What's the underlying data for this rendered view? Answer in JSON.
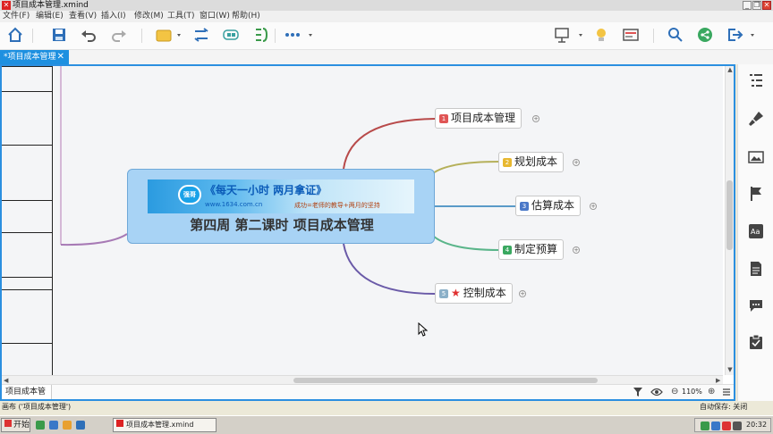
{
  "window": {
    "title": "项目成本管理.xmind",
    "minimize": "_",
    "restore": "❐",
    "close": "✕"
  },
  "menu": [
    "文件(F)",
    "编辑(E)",
    "查看(V)",
    "插入(I)",
    "修改(M)",
    "工具(T)",
    "窗口(W)",
    "帮助(H)"
  ],
  "toolbar": {
    "icons": [
      "home-icon",
      "save-icon",
      "undo-icon",
      "redo-icon",
      "topic-icon",
      "relationship-icon",
      "boundary-icon",
      "summary-icon",
      "more-icon",
      "presentation-icon",
      "idea-icon",
      "layout-icon",
      "search-icon",
      "share-icon",
      "export-icon"
    ]
  },
  "tab": {
    "label": "*项目成本管理",
    "close": "✕"
  },
  "mindmap": {
    "central": {
      "banner_badge": "强哥",
      "banner_slogan": "《每天一小时 两月拿证》",
      "banner_site": "www.1634.com.cn",
      "banner_motto": "成功=老师的教导+两月的坚持",
      "title": "第四周  第二课时    项目成本管理"
    },
    "topics": [
      {
        "number": "1",
        "label": "项目成本管理",
        "color": "#e05555",
        "has_star": false
      },
      {
        "number": "2",
        "label": "规划成本",
        "color": "#e8b830",
        "has_star": false
      },
      {
        "number": "3",
        "label": "估算成本",
        "color": "#4a78c8",
        "has_star": false
      },
      {
        "number": "4",
        "label": "制定预算",
        "color": "#3aa860",
        "has_star": false
      },
      {
        "number": "5",
        "label": "控制成本",
        "color": "#8bb0c8",
        "has_star": true
      }
    ],
    "expander_symbol": "+"
  },
  "status": {
    "sheet_tab": "项目成本管理",
    "zoom": "110%",
    "zoom_out": "⊖",
    "zoom_in": "⊕"
  },
  "app_status": {
    "left": "画布 ('项目成本管理')",
    "right": "自动保存: 关闭"
  },
  "taskbar": {
    "start": "开始",
    "task": "项目成本管理.xmind",
    "time": "20:32"
  }
}
